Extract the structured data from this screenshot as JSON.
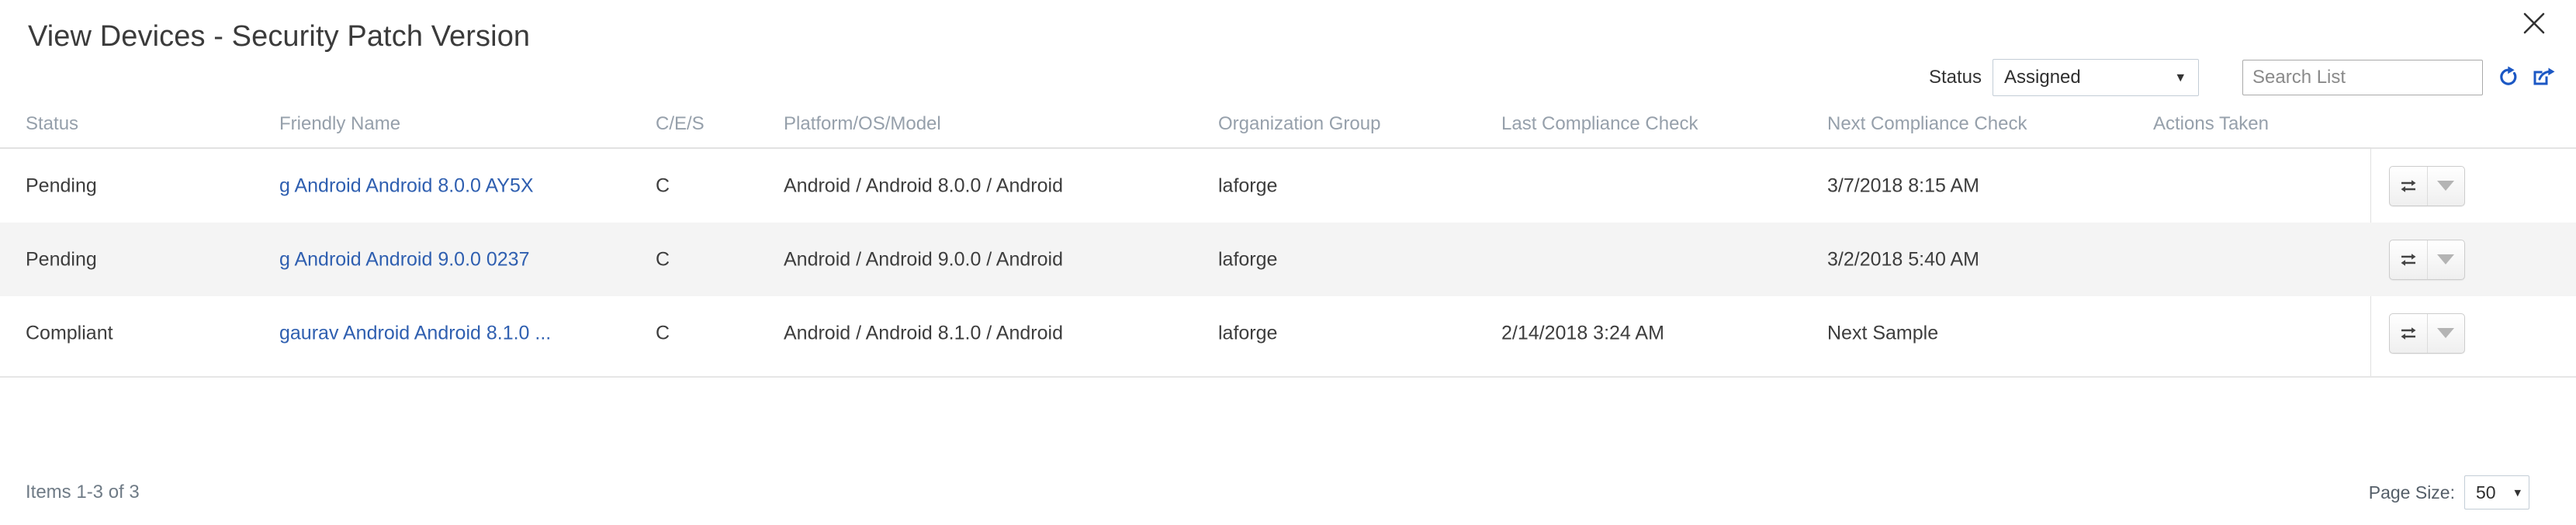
{
  "modal": {
    "title": "View Devices - Security Patch Version",
    "close_icon": "close-icon"
  },
  "filters": {
    "status_label": "Status",
    "status_value": "Assigned",
    "status_options": [
      "Assigned"
    ],
    "search_placeholder": "Search List",
    "search_value": "",
    "refresh_icon": "refresh-icon",
    "export_icon": "export-icon",
    "accent_color": "#1c58c4"
  },
  "table": {
    "columns": [
      "Status",
      "Friendly Name",
      "C/E/S",
      "Platform/OS/Model",
      "Organization Group",
      "Last Compliance Check",
      "Next Compliance Check",
      "Actions Taken"
    ],
    "rows": [
      {
        "status": "Pending",
        "friendly_name": "g Android Android 8.0.0 AY5X",
        "ces": "C",
        "platform": "Android / Android 8.0.0 / Android",
        "org_group": "laforge",
        "last_check": "",
        "next_check": "3/7/2018 8:15 AM",
        "actions_taken": ""
      },
      {
        "status": "Pending",
        "friendly_name": "g Android Android 9.0.0 0237",
        "ces": "C",
        "platform": "Android / Android 9.0.0 / Android",
        "org_group": "laforge",
        "last_check": "",
        "next_check": "3/2/2018 5:40 AM",
        "actions_taken": ""
      },
      {
        "status": "Compliant",
        "friendly_name": "gaurav Android Android 8.1.0 ...",
        "ces": "C",
        "platform": "Android / Android 8.1.0 / Android",
        "org_group": "laforge",
        "last_check": "2/14/2018 3:24 AM",
        "next_check": "Next Sample",
        "actions_taken": ""
      }
    ],
    "row_action": {
      "sync_icon": "sync-icon",
      "caret_icon": "caret-down-icon"
    },
    "link_color": "#2f5fb0",
    "alt_row_color": "#f4f4f4"
  },
  "footer": {
    "items_count": "Items 1-3 of 3",
    "page_size_label": "Page Size:",
    "page_size_value": "50",
    "page_size_options": [
      "50"
    ]
  }
}
